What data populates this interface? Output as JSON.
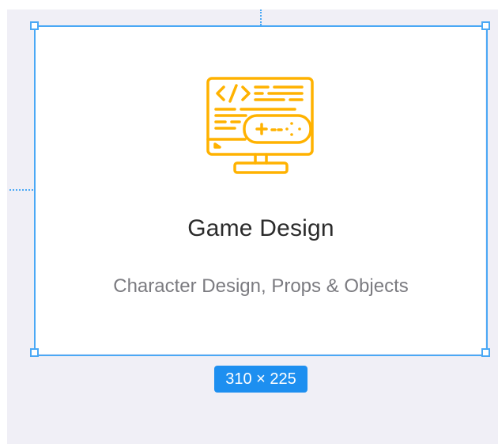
{
  "card": {
    "title": "Game Design",
    "subtitle": "Character Design, Props & Objects",
    "icon": "monitor-code-gamepad-icon"
  },
  "selection": {
    "size_label": "310 × 225"
  },
  "colors": {
    "canvas_bg": "#f0eff6",
    "selection_accent": "#4aa8f5",
    "badge_bg": "#1d8ff0",
    "icon_color": "#ffb200",
    "title_color": "#2b2b2b",
    "subtitle_color": "#7b7b80"
  }
}
